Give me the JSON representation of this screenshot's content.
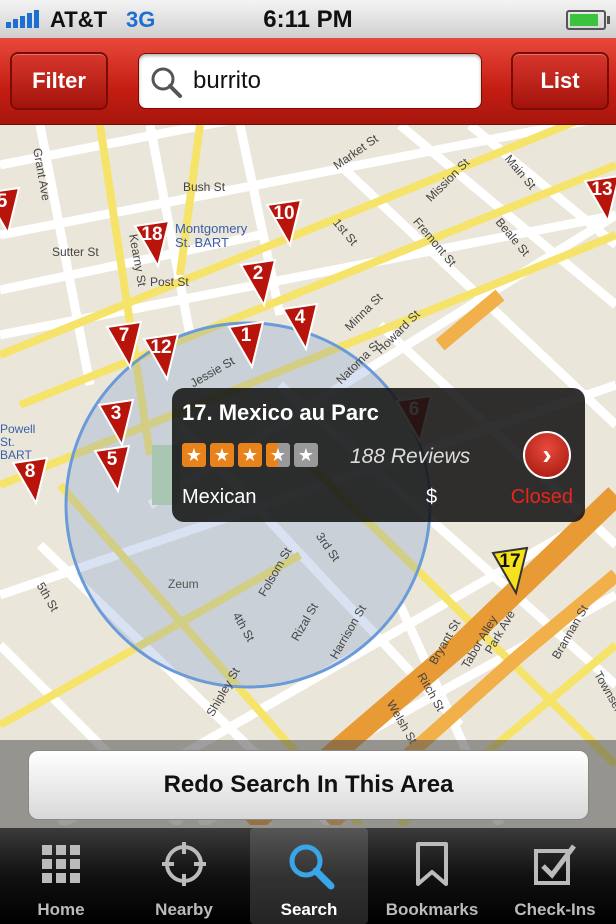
{
  "status_bar": {
    "carrier": "AT&T",
    "network": "3G",
    "time": "6:11 PM"
  },
  "toolbar": {
    "filter_label": "Filter",
    "search_value": "burrito",
    "list_label": "List"
  },
  "map": {
    "streets": [
      "Bush St",
      "Sutter St",
      "Post St",
      "Grant Ave",
      "Kearny St",
      "Montgomery St. BART",
      "Jessie St",
      "Market St",
      "Mission St",
      "1st St",
      "Fremont St",
      "Beale St",
      "Main St",
      "Minna St",
      "Natoma St",
      "Howard St",
      "Folsom St",
      "3rd St",
      "Zeum",
      "Rizal St",
      "Harrison St",
      "4th St",
      "5th St",
      "Shipley St",
      "Bryant St",
      "Tabor Alley",
      "Park Ave",
      "Brannan St",
      "Ritch St",
      "Welsh St",
      "Powell St. BART",
      "Townsend St"
    ],
    "pins": [
      "5",
      "18",
      "10",
      "2",
      "4",
      "1",
      "7",
      "12",
      "3",
      "5",
      "8",
      "13",
      "6",
      "17"
    ]
  },
  "callout": {
    "name": "17. Mexico au Parc",
    "rating": 3.5,
    "reviews": "188 Reviews",
    "category": "Mexican",
    "price": "$",
    "open_status": "Closed"
  },
  "redo_label": "Redo Search In This Area",
  "tabs": [
    {
      "label": "Home",
      "icon": "grid-icon"
    },
    {
      "label": "Nearby",
      "icon": "crosshair-icon"
    },
    {
      "label": "Search",
      "icon": "search-icon",
      "active": true
    },
    {
      "label": "Bookmarks",
      "icon": "bookmark-icon"
    },
    {
      "label": "Check-Ins",
      "icon": "checkbox-icon"
    }
  ],
  "colors": {
    "brand_red": "#c41d12",
    "star_orange": "#e8821a",
    "closed_red": "#e8261a",
    "active_tab_blue": "#3aa6e8"
  }
}
